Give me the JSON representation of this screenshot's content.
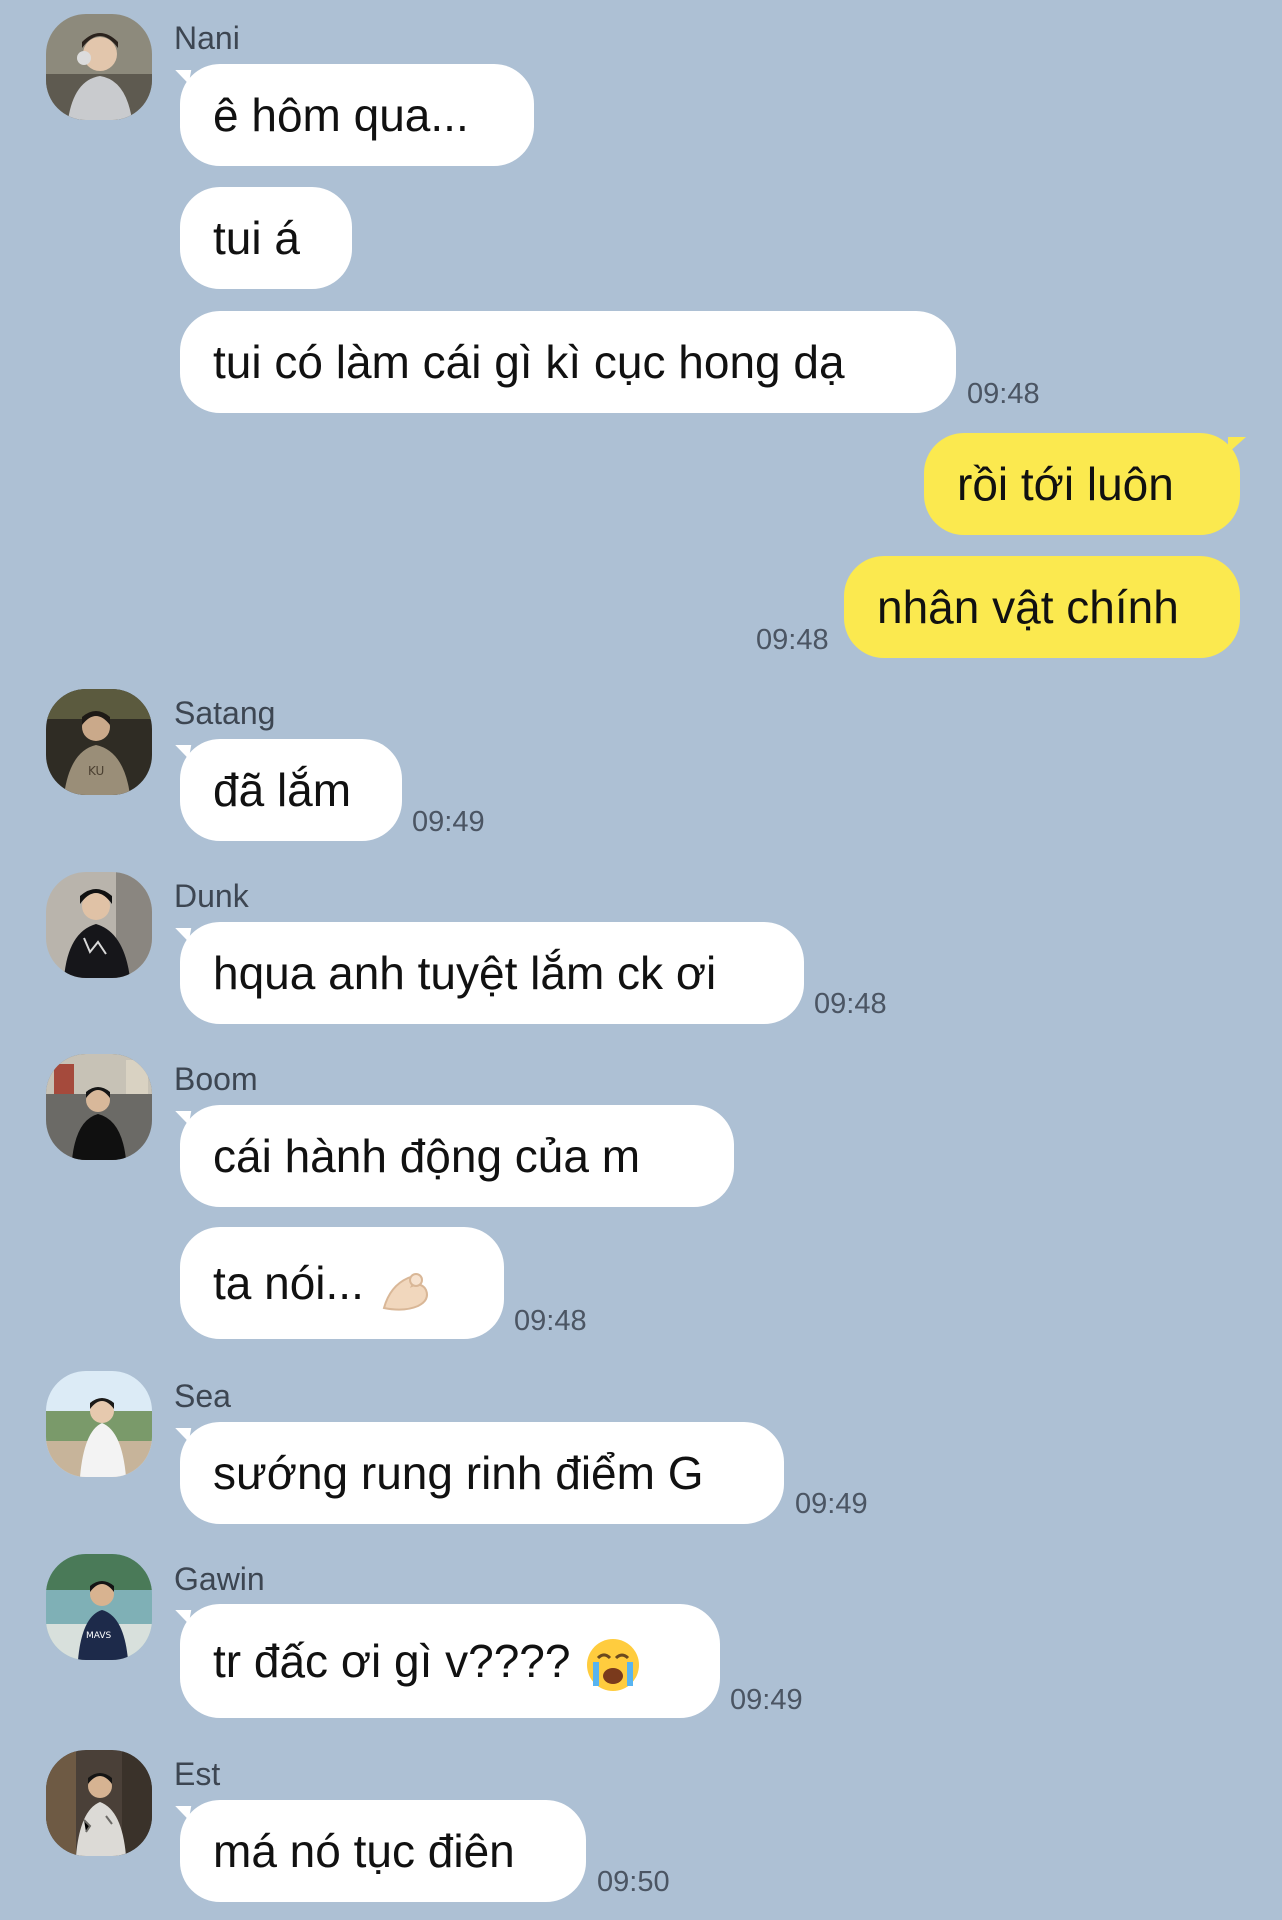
{
  "colors": {
    "background": "#adc0d4",
    "incoming_bubble": "#ffffff",
    "outgoing_bubble": "#fbe94f",
    "name_text": "#3d4652",
    "timestamp_text": "#4b5563"
  },
  "messages": {
    "nani": {
      "name": "Nani",
      "m1": "ê hôm qua...",
      "m2": "tui á",
      "m3": "tui có làm cái gì kì cục hong dạ",
      "time": "09:48"
    },
    "me": {
      "m1": "rồi tới luôn",
      "m2": "nhân vật chính",
      "time": "09:48"
    },
    "satang": {
      "name": "Satang",
      "m1": "đã lắm",
      "time": "09:49"
    },
    "dunk": {
      "name": "Dunk",
      "m1": "hqua anh tuyệt lắm ck ơi",
      "time": "09:48"
    },
    "boom": {
      "name": "Boom",
      "m1": "cái hành động của m",
      "m2": "ta nói...",
      "m2_emoji": "pinching-hand-emoji",
      "time": "09:48"
    },
    "sea": {
      "name": "Sea",
      "m1": "sướng rung rinh điểm G",
      "time": "09:49"
    },
    "gawin": {
      "name": "Gawin",
      "m1": "tr đấc ơi gì v????",
      "m1_emoji": "loudly-crying-face-emoji",
      "time": "09:49"
    },
    "est": {
      "name": "Est",
      "m1": "má nó tục điên",
      "time": "09:50"
    }
  }
}
